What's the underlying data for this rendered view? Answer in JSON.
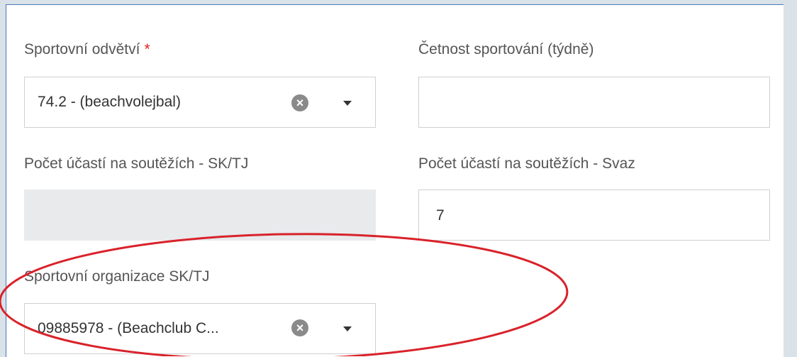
{
  "form": {
    "sport_branch": {
      "label": "Sportovní odvětví",
      "required_mark": "*",
      "value": "74.2 - (beachvolejbal)",
      "clear_icon": "times-circle-icon",
      "dropdown_icon": "caret-down-icon"
    },
    "frequency": {
      "label": "Četnost sportování (týdně)",
      "value": ""
    },
    "count_club": {
      "label": "Počet účastí na soutěžích - SK/TJ",
      "value": ""
    },
    "count_union": {
      "label": "Počet účastí na soutěžích - Svaz",
      "value": "7"
    },
    "organization": {
      "label": "Sportovní organizace SK/TJ",
      "value": "09885978 - (Beachclub C...",
      "clear_icon": "times-circle-icon",
      "dropdown_icon": "caret-down-icon"
    }
  },
  "annotation": {
    "shape": "ellipse",
    "color": "#d9222a"
  },
  "colors": {
    "panel_border": "#4a79b8",
    "background": "#d9e1e9",
    "disabled_field": "#e8eaec"
  }
}
